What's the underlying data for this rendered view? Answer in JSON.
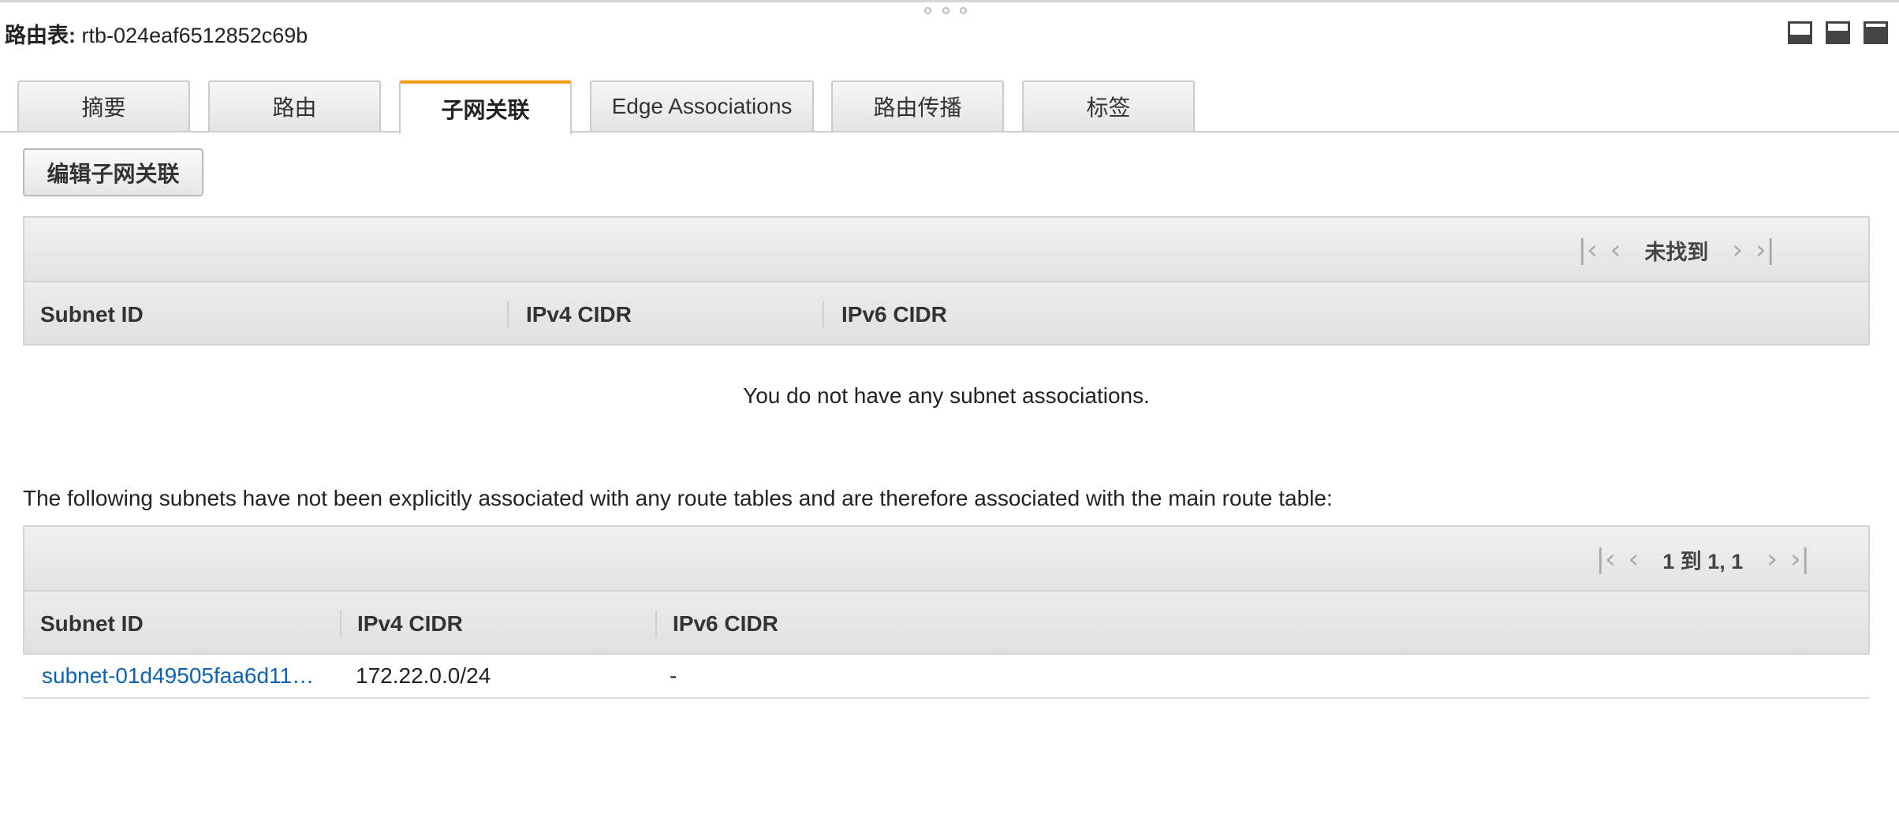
{
  "header": {
    "title_label": "路由表:",
    "title_value": "rtb-024eaf6512852c69b"
  },
  "tabs": [
    {
      "label": "摘要"
    },
    {
      "label": "路由"
    },
    {
      "label": "子网关联",
      "active": true
    },
    {
      "label": "Edge Associations"
    },
    {
      "label": "路由传播"
    },
    {
      "label": "标签"
    }
  ],
  "actions": {
    "edit_label": "编辑子网关联"
  },
  "explicit_table": {
    "pager_text": "未找到",
    "columns": [
      "Subnet ID",
      "IPv4 CIDR",
      "IPv6 CIDR"
    ],
    "empty_message": "You do not have any subnet associations."
  },
  "note": "The following subnets have not been explicitly associated with any route tables and are therefore associated with the main route table:",
  "implicit_table": {
    "pager_text": "1 到 1, 1",
    "columns": [
      "Subnet ID",
      "IPv4 CIDR",
      "IPv6 CIDR"
    ],
    "rows": [
      {
        "subnet_id": "subnet-01d49505faa6d11…",
        "ipv4": "172.22.0.0/24",
        "ipv6": "-"
      }
    ]
  },
  "colors": {
    "accent": "#f39c12",
    "link": "#0a63b4"
  }
}
